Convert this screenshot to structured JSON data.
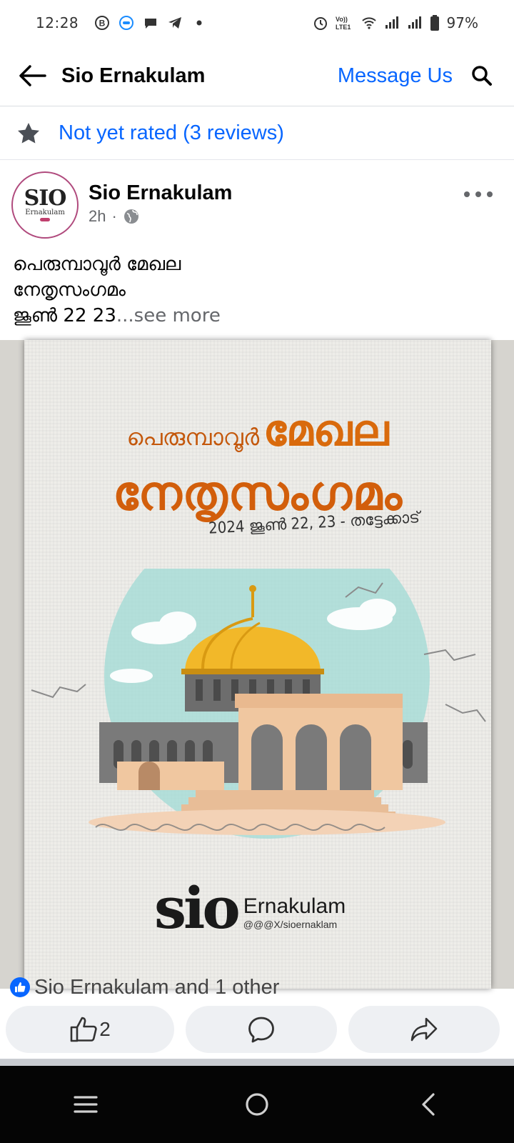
{
  "status_bar": {
    "time": "12:28",
    "battery": "97%",
    "left_icons": [
      "b-circle-icon",
      "imo-icon",
      "chat-bubble-icon",
      "telegram-icon",
      "dot-icon"
    ],
    "right_icons": [
      "alarm-icon",
      "volte-icon",
      "wifi-icon",
      "signal-icon",
      "signal-icon",
      "battery-icon"
    ]
  },
  "header": {
    "title": "Sio Ernakulam",
    "message_label": "Message Us"
  },
  "rating": {
    "text": "Not yet rated (3 reviews)"
  },
  "post": {
    "author": "Sio Ernakulam",
    "time": "2h",
    "avatar": {
      "logo_text": "SIO",
      "sub_text": "Ernakulam"
    },
    "text_lines": [
      "പെരുമ്പാവൂർ മേഖല",
      "നേതൃസംഗമം"
    ],
    "text_last": "ജൂൺ 22 23",
    "see_more": "...see more",
    "poster": {
      "title_small": "പെരുമ്പാവൂർ",
      "title_big": "മേഖല",
      "title_line2": "നേതൃസംഗമം",
      "date_line": "2024 ജൂൺ 22, 23 - തട്ടേക്കാട്",
      "logo_sio": "sio",
      "logo_place": "Ernakulam",
      "logo_handle": "@@@X/sioernaklam"
    }
  },
  "reactions": {
    "text": "Sio Ernakulam and 1 other",
    "like_count": "2"
  },
  "colors": {
    "accent": "#0866ff",
    "poster_orange": "#d96a0c",
    "dome_gold": "#f2b829",
    "sky": "#a8dcd7"
  }
}
